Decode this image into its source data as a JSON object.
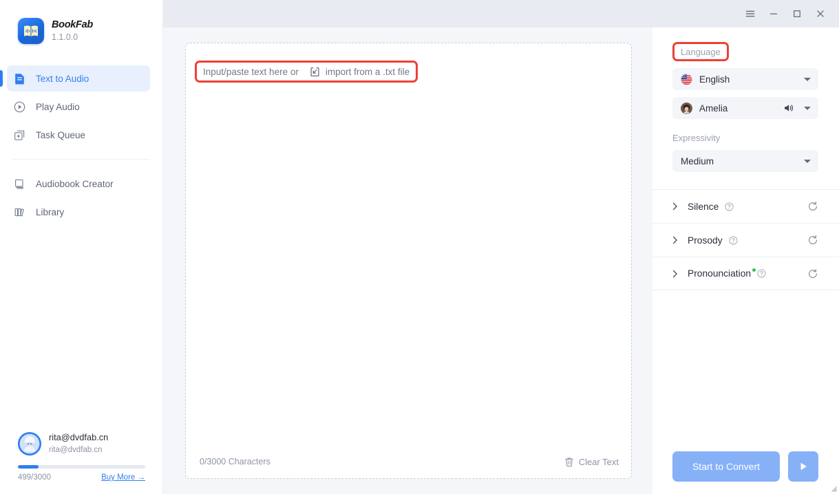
{
  "app": {
    "brand_name": "BookFab",
    "version": "1.1.0.0",
    "logo_icon": "book-audio-logo"
  },
  "titlebar": {
    "menu_icon": "hamburger-menu-icon",
    "minimize_icon": "minimize-icon",
    "maximize_icon": "maximize-icon",
    "close_icon": "close-icon"
  },
  "sidebar": {
    "items": [
      {
        "label": "Text to Audio",
        "icon": "document-text-icon",
        "active": true
      },
      {
        "label": "Play Audio",
        "icon": "play-circle-icon",
        "active": false
      },
      {
        "label": "Task Queue",
        "icon": "task-queue-icon",
        "active": false
      },
      {
        "label": "Audiobook Creator",
        "icon": "book-icon",
        "active": false
      },
      {
        "label": "Library",
        "icon": "library-icon",
        "active": false
      }
    ],
    "user": {
      "name": "rita@dvdfab.cn",
      "email": "rita@dvdfab.cn",
      "avatar_icon": "user-avatar",
      "quota_text": "499/3000",
      "quota_percent": 16,
      "buy_more_label": "Buy More →"
    }
  },
  "editor": {
    "placeholder_prefix": "Input/paste text here or",
    "import_icon": "import-file-icon",
    "import_label": "import from a .txt file",
    "char_count": "0/3000 Characters",
    "clear_icon": "trash-icon",
    "clear_label": "Clear Text",
    "highlight_color": "#ee4036"
  },
  "panel": {
    "language_label": "Language",
    "language_value": "English",
    "language_flag_icon": "us-flag-icon",
    "voice_value": "Amelia",
    "voice_avatar_icon": "voice-avatar-icon",
    "voice_preview_icon": "speaker-icon",
    "expressivity_label": "Expressivity",
    "expressivity_value": "Medium",
    "caret_icon": "chevron-down-icon",
    "sections": [
      {
        "title": "Silence",
        "help_icon": "help-icon",
        "reset_icon": "reset-icon",
        "chevron_icon": "chevron-right-icon",
        "modified": false
      },
      {
        "title": "Prosody",
        "help_icon": "help-icon",
        "reset_icon": "reset-icon",
        "chevron_icon": "chevron-right-icon",
        "modified": false
      },
      {
        "title": "Pronounciation",
        "help_icon": "help-icon",
        "reset_icon": "reset-icon",
        "chevron_icon": "chevron-right-icon",
        "modified": true
      }
    ],
    "convert_label": "Start to Convert",
    "play_icon": "play-icon",
    "accent_color": "#2f7ef0",
    "button_color": "#86b1f7",
    "modified_dot_color": "#33c25b"
  }
}
